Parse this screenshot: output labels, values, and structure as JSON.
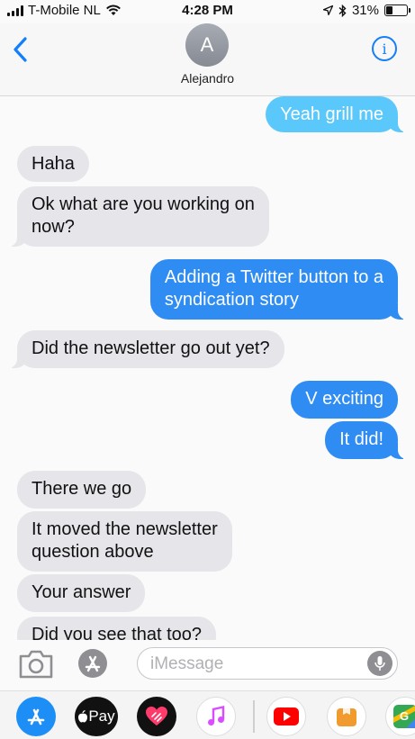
{
  "status_bar": {
    "carrier": "T-Mobile NL",
    "time": "4:28 PM",
    "battery_percent": "31%",
    "battery_level": 0.31,
    "icons": [
      "signal-bars-icon",
      "wifi-icon",
      "location-arrow-icon",
      "bluetooth-icon",
      "battery-icon"
    ]
  },
  "header": {
    "avatar_initial": "A",
    "contact_name": "Alejandro",
    "info_label": "i"
  },
  "messages": [
    {
      "from": "me",
      "text": "Yeah grill me",
      "tail": true
    },
    {
      "from": "them",
      "text": "Haha",
      "tail": false
    },
    {
      "from": "them",
      "text": "Ok what are you working on\nnow?",
      "tail": true
    },
    {
      "from": "me",
      "text": "Adding a Twitter button to a\nsyndication story",
      "tail": true
    },
    {
      "from": "them",
      "text": "Did the newsletter go out yet?",
      "tail": true
    },
    {
      "from": "me",
      "text": "V exciting",
      "tail": false
    },
    {
      "from": "me",
      "text": "It did!",
      "tail": true
    },
    {
      "from": "them",
      "text": "There we go",
      "tail": false
    },
    {
      "from": "them",
      "text": "It moved the newsletter\nquestion above",
      "tail": false
    },
    {
      "from": "them",
      "text": "Your answer",
      "tail": false
    },
    {
      "from": "them",
      "text": "Did you see that too?",
      "tail": false
    }
  ],
  "compose": {
    "placeholder": "iMessage"
  },
  "app_drawer": {
    "apple_pay_label": "Pay",
    "apps": [
      "app-store-icon",
      "apple-pay-icon",
      "digital-touch-icon",
      "music-icon",
      "youtube-icon",
      "app-extension-icon",
      "google-maps-icon"
    ]
  },
  "colors": {
    "outgoing_light": "#5ac8fa",
    "outgoing_blue": "#2f8cf2",
    "incoming": "#e5e5ea",
    "accent": "#147efb"
  }
}
